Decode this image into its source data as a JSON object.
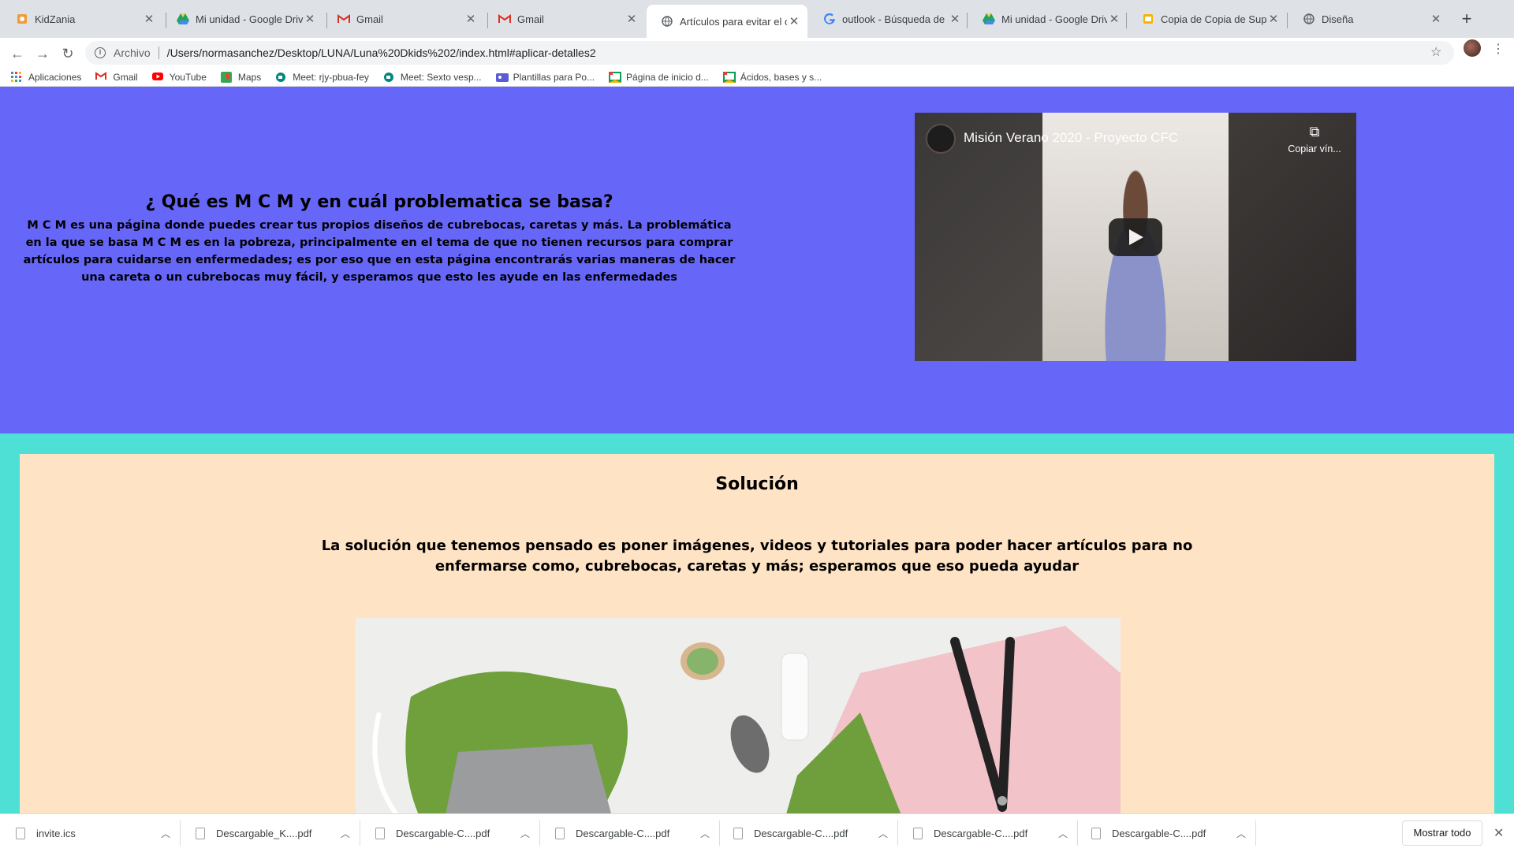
{
  "tabs": [
    {
      "title": "KidZania",
      "icon": "kidzania-icon",
      "color": "#f29b38"
    },
    {
      "title": "Mi unidad - Google Drive",
      "icon": "google-drive-icon",
      "color": "#1fa463"
    },
    {
      "title": "Gmail",
      "icon": "gmail-icon",
      "color": "#d93025"
    },
    {
      "title": "Gmail",
      "icon": "gmail-icon",
      "color": "#d93025"
    },
    {
      "title": "Artículos para evitar el c",
      "icon": "globe-icon",
      "color": "#5f6368"
    },
    {
      "title": "outlook - Búsqueda de G",
      "icon": "google-icon",
      "color": "#4285f4"
    },
    {
      "title": "Mi unidad - Google Drive",
      "icon": "google-drive-icon",
      "color": "#1fa463"
    },
    {
      "title": "Copia de Copia de Supe",
      "icon": "slides-icon",
      "color": "#f4b400"
    },
    {
      "title": "Diseña",
      "icon": "globe-icon",
      "color": "#5f6368"
    }
  ],
  "toolbar": {
    "scheme": "Archivo",
    "url": "/Users/normasanchez/Desktop/LUNA/Luna%20Dkids%202/index.html#aplicar-detalles2"
  },
  "bookmarks": [
    {
      "label": "Aplicaciones",
      "icon": "apps-grid-icon"
    },
    {
      "label": "Gmail",
      "icon": "gmail-icon"
    },
    {
      "label": "YouTube",
      "icon": "youtube-icon"
    },
    {
      "label": "Maps",
      "icon": "maps-icon"
    },
    {
      "label": "Meet: rjy-pbua-fey",
      "icon": "meet-icon"
    },
    {
      "label": "Meet: Sexto vesp...",
      "icon": "meet-icon"
    },
    {
      "label": "Plantillas para Po...",
      "icon": "template-icon"
    },
    {
      "label": "Página de inicio d...",
      "icon": "classroom-icon"
    },
    {
      "label": "Ácidos, bases y s...",
      "icon": "classroom-icon"
    }
  ],
  "hero": {
    "heading": "¿ Qué es M C M y en cuál problematica se basa?",
    "body": "M C M es una página donde puedes crear tus propios diseños de cubrebocas, caretas y más. La problemática en la que se basa M C M es en la pobreza, principalmente en el tema de que no tienen recursos para comprar artículos para cuidarse en enfermedades; es por eso que en esta página encontrarás varias maneras de hacer una careta o un cubrebocas muy fácil, y esperamos que esto les ayude en las enfermedades",
    "background": "#6667f9"
  },
  "video": {
    "title": "Misión Verano 2020 - Proyecto CFC",
    "copy_label": "Copiar vín..."
  },
  "solution": {
    "heading": "Solución",
    "body": "La solución que tenemos pensado es poner imágenes, videos y tutoriales para poder hacer artículos para no enfermarse como, cubrebocas, caretas y más; esperamos que eso pueda ayudar",
    "card_color": "#ffe3c5",
    "border_color": "#4ee0d4"
  },
  "downloads": [
    {
      "name": "invite.ics"
    },
    {
      "name": "Descargable_K....pdf"
    },
    {
      "name": "Descargable-C....pdf"
    },
    {
      "name": "Descargable-C....pdf"
    },
    {
      "name": "Descargable-C....pdf"
    },
    {
      "name": "Descargable-C....pdf"
    },
    {
      "name": "Descargable-C....pdf"
    }
  ],
  "downloads_show_all": "Mostrar todo"
}
